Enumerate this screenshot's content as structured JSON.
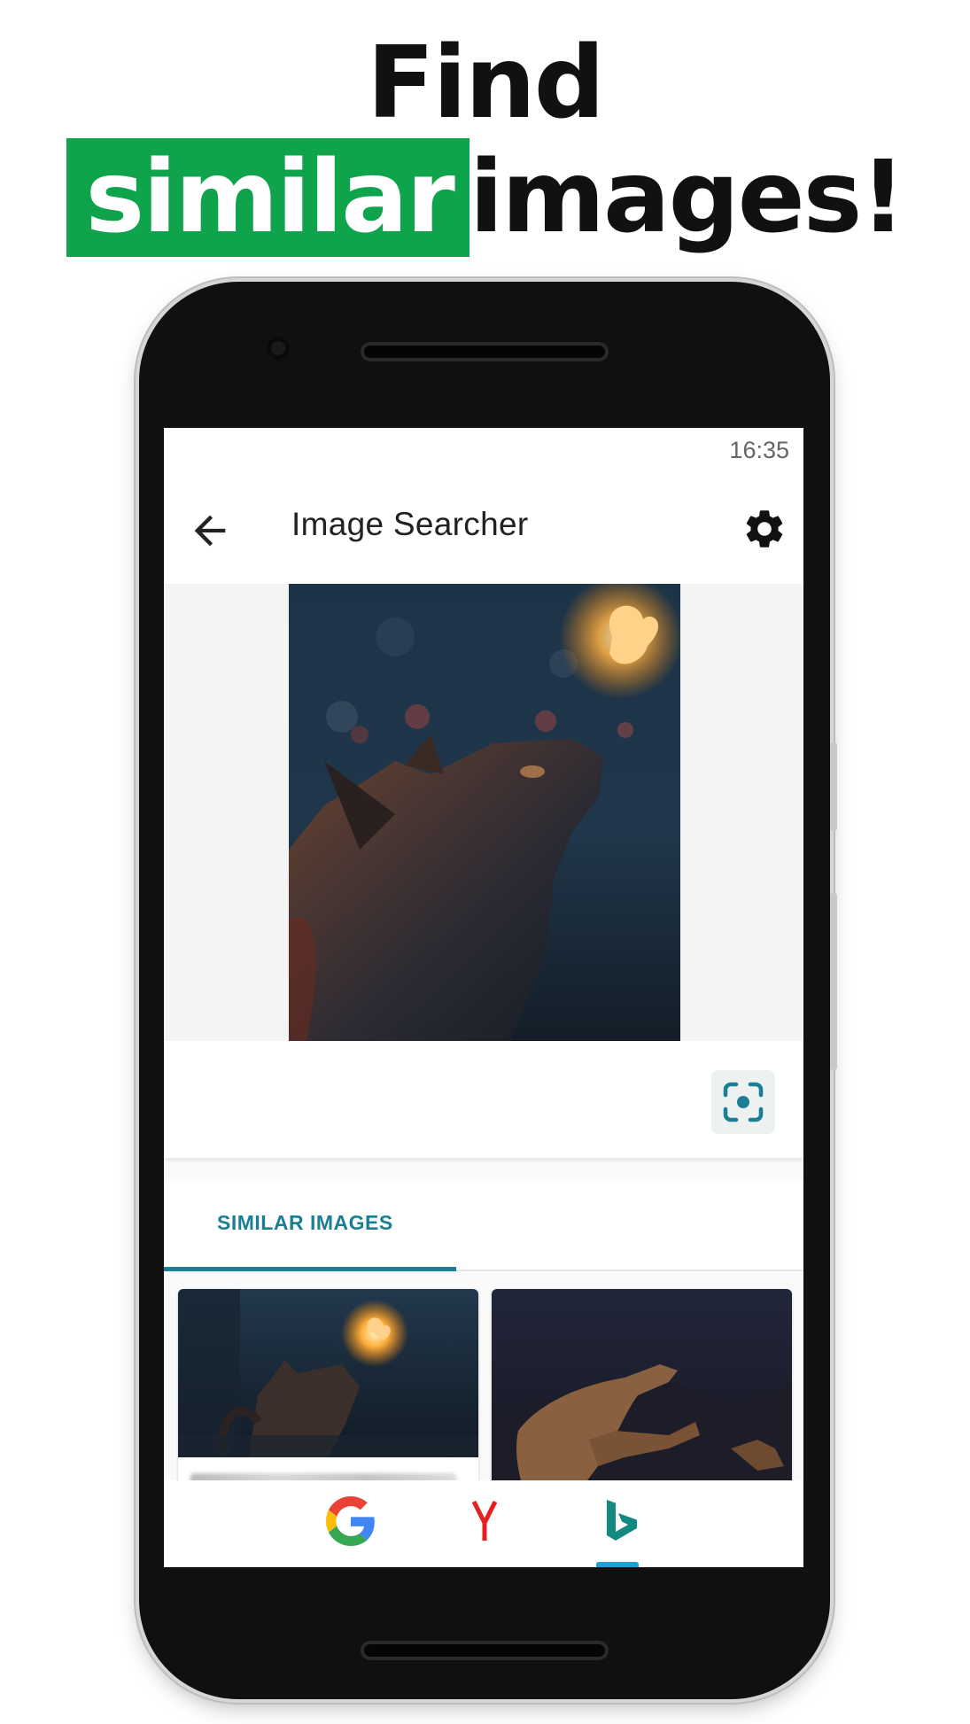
{
  "promo": {
    "line1": "Find",
    "highlight": "similar",
    "rest": "images!",
    "highlight_color": "#0fa34b"
  },
  "status_bar": {
    "time": "16:35"
  },
  "app_bar": {
    "back_icon": "arrow-left-icon",
    "title": "Image Searcher",
    "settings_icon": "gear-icon"
  },
  "query_image": {
    "subject": "cat looking up at glowing butterfly"
  },
  "actions": {
    "lens_icon": "focus-scan-icon"
  },
  "tabs": [
    {
      "label": "SIMILAR IMAGES",
      "selected": true
    }
  ],
  "results": [
    {
      "thumbnail": "cat and glowing butterfly in dark street"
    },
    {
      "thumbnail": "dinosaurs at night"
    }
  ],
  "search_engines": [
    {
      "name": "Google",
      "icon": "google-g-icon",
      "selected": false
    },
    {
      "name": "Yandex",
      "icon": "yandex-y-icon",
      "selected": false
    },
    {
      "name": "Bing",
      "icon": "bing-b-icon",
      "selected": true
    }
  ],
  "colors": {
    "accent": "#1a7f93",
    "bing_indicator": "#1f9fd6"
  }
}
